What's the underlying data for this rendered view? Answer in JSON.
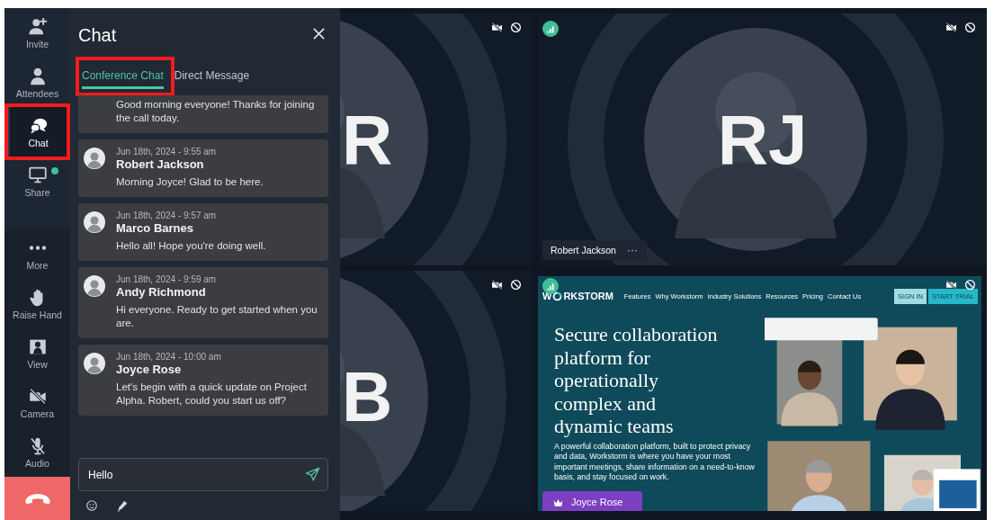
{
  "sidebar": {
    "groups": [
      {
        "items": [
          {
            "kind": "invite",
            "label": "Invite",
            "selected": false,
            "indicator": false,
            "annotated": false
          },
          {
            "kind": "attendees",
            "label": "Attendees",
            "selected": false,
            "indicator": false,
            "annotated": false
          },
          {
            "kind": "chat",
            "label": "Chat",
            "selected": true,
            "indicator": false,
            "annotated": true
          },
          {
            "kind": "share",
            "label": "Share",
            "selected": false,
            "indicator": true,
            "annotated": false
          }
        ]
      },
      {
        "items": [
          {
            "kind": "more",
            "label": "More",
            "selected": false,
            "indicator": false,
            "annotated": false
          },
          {
            "kind": "raise",
            "label": "Raise Hand",
            "selected": false,
            "indicator": false,
            "annotated": false
          },
          {
            "kind": "view",
            "label": "View",
            "selected": false,
            "indicator": false,
            "annotated": false
          },
          {
            "kind": "camera",
            "label": "Camera",
            "selected": false,
            "indicator": false,
            "annotated": false
          },
          {
            "kind": "audio",
            "label": "Audio",
            "selected": false,
            "indicator": false,
            "annotated": false
          }
        ]
      }
    ]
  },
  "chat": {
    "title": "Chat",
    "tabs": [
      {
        "label": "Conference Chat",
        "selected": true,
        "annotated": true
      },
      {
        "label": "Direct Message",
        "selected": false,
        "annotated": false
      }
    ],
    "messages": [
      {
        "kind": "continued",
        "text": "Good morning everyone! Thanks for joining the call today."
      },
      {
        "kind": "message",
        "time": "Jun 18th, 2024 - 9:55 am",
        "author": "Robert Jackson",
        "text": "Morning Joyce! Glad to be here."
      },
      {
        "kind": "message",
        "time": "Jun 18th, 2024 - 9:57 am",
        "author": "Marco Barnes",
        "text": "Hello all! Hope you're doing well."
      },
      {
        "kind": "message",
        "time": "Jun 18th, 2024 - 9:59 am",
        "author": "Andy Richmond",
        "text": "Hi everyone. Ready to get started when you are."
      },
      {
        "kind": "message",
        "time": "Jun 18th, 2024 - 10:00 am",
        "author": "Joyce Rose",
        "text": "Let's begin with a quick update on Project Alpha. Robert, could you start us off?"
      }
    ],
    "composer": {
      "value": "Hello"
    }
  },
  "video": {
    "tiles": [
      {
        "kind": "avatar",
        "initials": "R",
        "cropped": true,
        "signal": false
      },
      {
        "kind": "avatar",
        "initials": "RJ",
        "cropped": false,
        "signal": true,
        "name": "Robert Jackson",
        "menu": "···"
      },
      {
        "kind": "avatar",
        "initials": "B",
        "cropped": true,
        "signal": false
      },
      {
        "kind": "screen",
        "signal": true,
        "name": "Joyce Rose",
        "host": true,
        "screen": {
          "logo": [
            "W",
            "RKSTORM"
          ],
          "nav": [
            "Features",
            "Why Workstorm",
            "Industry Solutions",
            "Resources",
            "Pricing",
            "Contact Us"
          ],
          "buttons": [
            {
              "label": "SIGN IN",
              "kind": "secondary"
            },
            {
              "label": "START TRIAL",
              "kind": "primary"
            }
          ],
          "headline": "Secure collaboration\nplatform for\noperationally\ncomplex and\ndynamic teams",
          "text": "A powerful collaboration platform, built to protect privacy and data, Workstorm is where you have your most important meetings, share information on a need-to-know basis, and stay focused on work."
        }
      }
    ]
  }
}
